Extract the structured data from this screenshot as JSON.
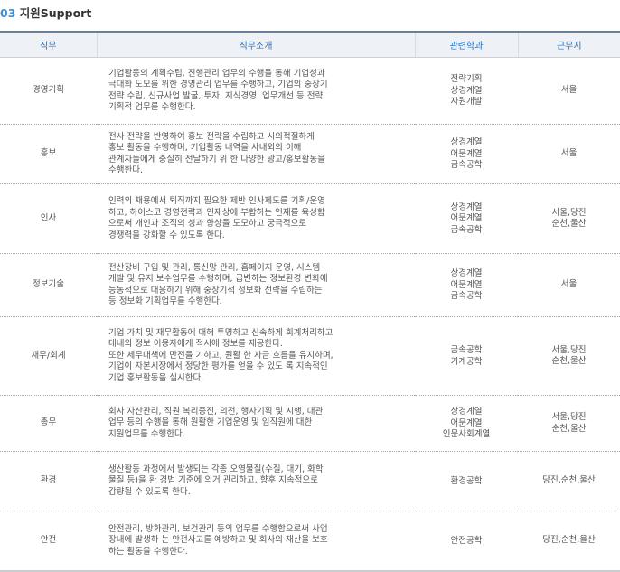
{
  "section": {
    "number": "03",
    "title": "지원Support"
  },
  "table": {
    "headers": {
      "job": "직무",
      "description": "직무소개",
      "department": "관련학과",
      "location": "근무지"
    },
    "rows": [
      {
        "job": "경영기획",
        "description": [
          "기업활동의 계획수립, 진행관리 업무의 수행을 통해 기업성과",
          "극대화 도모를 위한 경영관리 업무를 수행하고, 기업의 중장기",
          "전략 수립, 신규사업 발굴, 투자, 지식경영, 업무개선 등 전략",
          "기획적 업무를 수행한다."
        ],
        "departments": [
          "전략기획",
          "상경계열",
          "자원개발"
        ],
        "locations": [
          "서울"
        ]
      },
      {
        "job": "홍보",
        "description": [
          "전사 전략을 반영하여 홍보 전략을 수립하고 시의적절하게",
          "홍보 활동을 수행하며, 기업활동 내역을 사내외의 이해",
          "관계자들에게 충실히 전달하기 위 한 다양한 광고/홍보활동을",
          "수행한다."
        ],
        "departments": [
          "상경계열",
          "어문계열",
          "금속공학"
        ],
        "locations": [
          "서울"
        ]
      },
      {
        "job": "인사",
        "description": [
          "인력의 채용에서 퇴직까지 필요한 제반 인사제도를 기획/운영",
          "하고, 하이스코 경영전략과 인재상에 부합하는 인재를 육성함",
          "으로써 개인과 조직의 성과 향상을 도모하고 궁극적으로",
          "경쟁력을 강화할 수 있도록 한다."
        ],
        "departments": [
          "상경계열",
          "어문계열",
          "금속공학"
        ],
        "locations": [
          "서울,당진",
          "순천,울산"
        ]
      },
      {
        "job": "정보기술",
        "description": [
          "전산장비 구입 및 관리, 통신망 관리, 홈페이지 운영, 시스템",
          "개발 및 유지 보수업무를 수행하며, 급변하는 정보환경 변화에",
          "능동적으로 대응하기 위해 중장기적 정보화 전략을 수립하는",
          "등 정보화 기획업무를 수행한다."
        ],
        "departments": [
          "상경계열",
          "어문계열",
          "금속공학"
        ],
        "locations": [
          "서울"
        ]
      },
      {
        "job": "재무/회계",
        "description": [
          "기업 가치 및 재무활동에 대해 투명하고 신속하게 회계처리하고",
          "대내외 정보 이용자에게 적시에 정보를 제공한다.",
          "또한 세무대책에 만전을 기하고, 원활 한 자금 흐름을 유지하며,",
          "기업이 자본시장에서 정당한 평가를 얻을 수 있도 록 지속적인",
          "기업 홍보활동을 실시한다."
        ],
        "departments": [
          "금속공학",
          "기계공학"
        ],
        "locations": [
          "서울,당진",
          "순천,울산"
        ]
      },
      {
        "job": "총무",
        "description": [
          "회사 자산관리, 직원 복리증진, 의전, 행사기획 및 시행, 대관",
          "업무 등의 수행을 통해 원활한 기업운영 및 임직원에 대한",
          "지원업무를 수행한다."
        ],
        "departments": [
          "상경계열",
          "어문계열",
          "인문사회계열"
        ],
        "locations": [
          "서울,당진",
          "순천,울산"
        ]
      },
      {
        "job": "환경",
        "description": [
          "생산활동 과정에서 발생되는 각종 오염물질(수질, 대기, 화학",
          "물질 등)을 환 경법 기준에 의거 관리하고, 향후 지속적으로",
          "감량될 수 있도록 한다."
        ],
        "departments": [
          "환경공학"
        ],
        "locations": [
          "당진,순천,울산"
        ]
      },
      {
        "job": "안전",
        "description": [
          "안전관리, 방화관리, 보건관리 등의 업무를 수행함으로써 사업",
          "장내에 발생하 는 안전사고를 예방하고 및 회사의 재산을 보호",
          "하는 활동을 수행한다."
        ],
        "departments": [
          "안전공학"
        ],
        "locations": [
          "당진,순천,울산"
        ]
      }
    ]
  }
}
